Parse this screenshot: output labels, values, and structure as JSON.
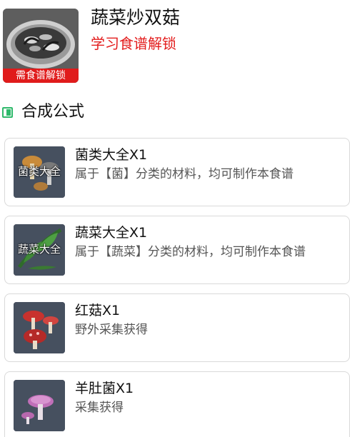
{
  "dish": {
    "title": "蔬菜炒双菇",
    "unlock_hint": "学习食谱解锁",
    "lock_badge": "需食谱解锁",
    "image_icon": "stir-fried-mushroom-dish"
  },
  "section": {
    "title": "合成公式",
    "icon": "recipe-section-icon",
    "icon_color": "#2fb96b"
  },
  "ingredients": [
    {
      "name": "菌类大全X1",
      "desc": "属于【菌】分类的材料，均可制作本食谱",
      "thumb_label": "菌类大全",
      "icon": "mushroom-category-icon"
    },
    {
      "name": "蔬菜大全X1",
      "desc": "属于【蔬菜】分类的材料，均可制作本食谱",
      "thumb_label": "蔬菜大全",
      "icon": "vegetable-category-icon"
    },
    {
      "name": "红菇X1",
      "desc": "野外采集获得",
      "icon": "red-mushroom-icon"
    },
    {
      "name": "羊肚菌X1",
      "desc": "采集获得",
      "icon": "morel-mushroom-icon"
    }
  ],
  "colors": {
    "accent_red": "#e31c1c",
    "badge_red": "#e01b1b",
    "section_green": "#2fb96b"
  }
}
